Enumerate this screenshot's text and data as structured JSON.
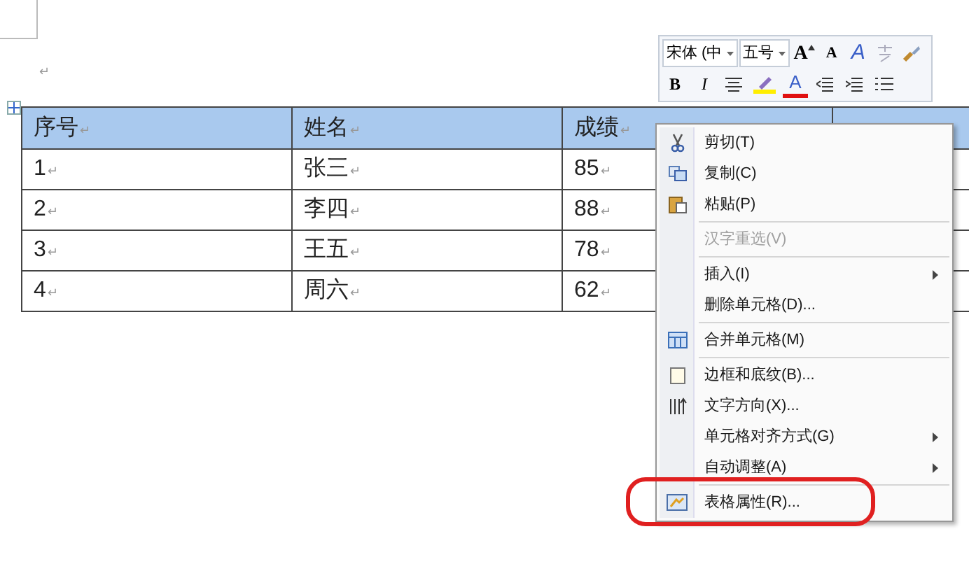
{
  "document": {
    "paragraph_mark": "↵",
    "table": {
      "columns": [
        {
          "text": "序号",
          "mark": "↵"
        },
        {
          "text": "姓名",
          "mark": "↵"
        },
        {
          "text": "成绩",
          "mark": "↵"
        }
      ],
      "rows": [
        [
          {
            "text": "1",
            "mark": "↵"
          },
          {
            "text": "张三",
            "mark": "↵"
          },
          {
            "text": "85",
            "mark": "↵"
          }
        ],
        [
          {
            "text": "2",
            "mark": "↵"
          },
          {
            "text": "李四",
            "mark": "↵"
          },
          {
            "text": "88",
            "mark": "↵"
          }
        ],
        [
          {
            "text": "3",
            "mark": "↵"
          },
          {
            "text": "王五",
            "mark": "↵"
          },
          {
            "text": "78",
            "mark": "↵"
          }
        ],
        [
          {
            "text": "4",
            "mark": "↵"
          },
          {
            "text": "周六",
            "mark": "↵"
          },
          {
            "text": "62",
            "mark": "↵"
          }
        ]
      ]
    }
  },
  "mini_toolbar": {
    "font": "宋体 (中",
    "size": "五号",
    "row1": [
      {
        "kind": "grow",
        "glyph": "A"
      },
      {
        "kind": "shrink",
        "glyph": "A"
      },
      {
        "kind": "styles",
        "glyph": "A"
      },
      {
        "kind": "phonetic"
      },
      {
        "kind": "brush"
      }
    ],
    "row2": [
      {
        "kind": "bold",
        "glyph": "B"
      },
      {
        "kind": "italic",
        "glyph": "I"
      },
      {
        "kind": "center"
      },
      {
        "kind": "highlight"
      },
      {
        "kind": "color",
        "glyph": "A"
      },
      {
        "kind": "outdent"
      },
      {
        "kind": "indent"
      },
      {
        "kind": "bullets"
      }
    ]
  },
  "context_menu": {
    "items": [
      {
        "kind": "cut",
        "label": "剪切(T)",
        "disabled": false,
        "submenu": false,
        "circled": false
      },
      {
        "kind": "copy",
        "label": "复制(C)",
        "disabled": false,
        "submenu": false,
        "circled": false
      },
      {
        "kind": "paste",
        "label": "粘贴(P)",
        "disabled": false,
        "submenu": false,
        "circled": false
      },
      {
        "kind": "separator"
      },
      {
        "kind": "plain",
        "label": "汉字重选(V)",
        "disabled": true,
        "submenu": false,
        "circled": false
      },
      {
        "kind": "separator"
      },
      {
        "kind": "plain",
        "label": "插入(I)",
        "disabled": false,
        "submenu": true,
        "circled": false
      },
      {
        "kind": "plain",
        "label": "删除单元格(D)...",
        "disabled": false,
        "submenu": false,
        "circled": false
      },
      {
        "kind": "separator"
      },
      {
        "kind": "merge",
        "label": "合并单元格(M)",
        "disabled": false,
        "submenu": false,
        "circled": false
      },
      {
        "kind": "separator"
      },
      {
        "kind": "border",
        "label": "边框和底纹(B)...",
        "disabled": false,
        "submenu": false,
        "circled": false
      },
      {
        "kind": "direction",
        "label": "文字方向(X)...",
        "disabled": false,
        "submenu": false,
        "circled": false
      },
      {
        "kind": "plain",
        "label": "单元格对齐方式(G)",
        "disabled": false,
        "submenu": true,
        "circled": false
      },
      {
        "kind": "plain",
        "label": "自动调整(A)",
        "disabled": false,
        "submenu": true,
        "circled": false
      },
      {
        "kind": "separator"
      },
      {
        "kind": "properties",
        "label": "表格属性(R)...",
        "disabled": false,
        "submenu": false,
        "circled": true
      }
    ]
  }
}
